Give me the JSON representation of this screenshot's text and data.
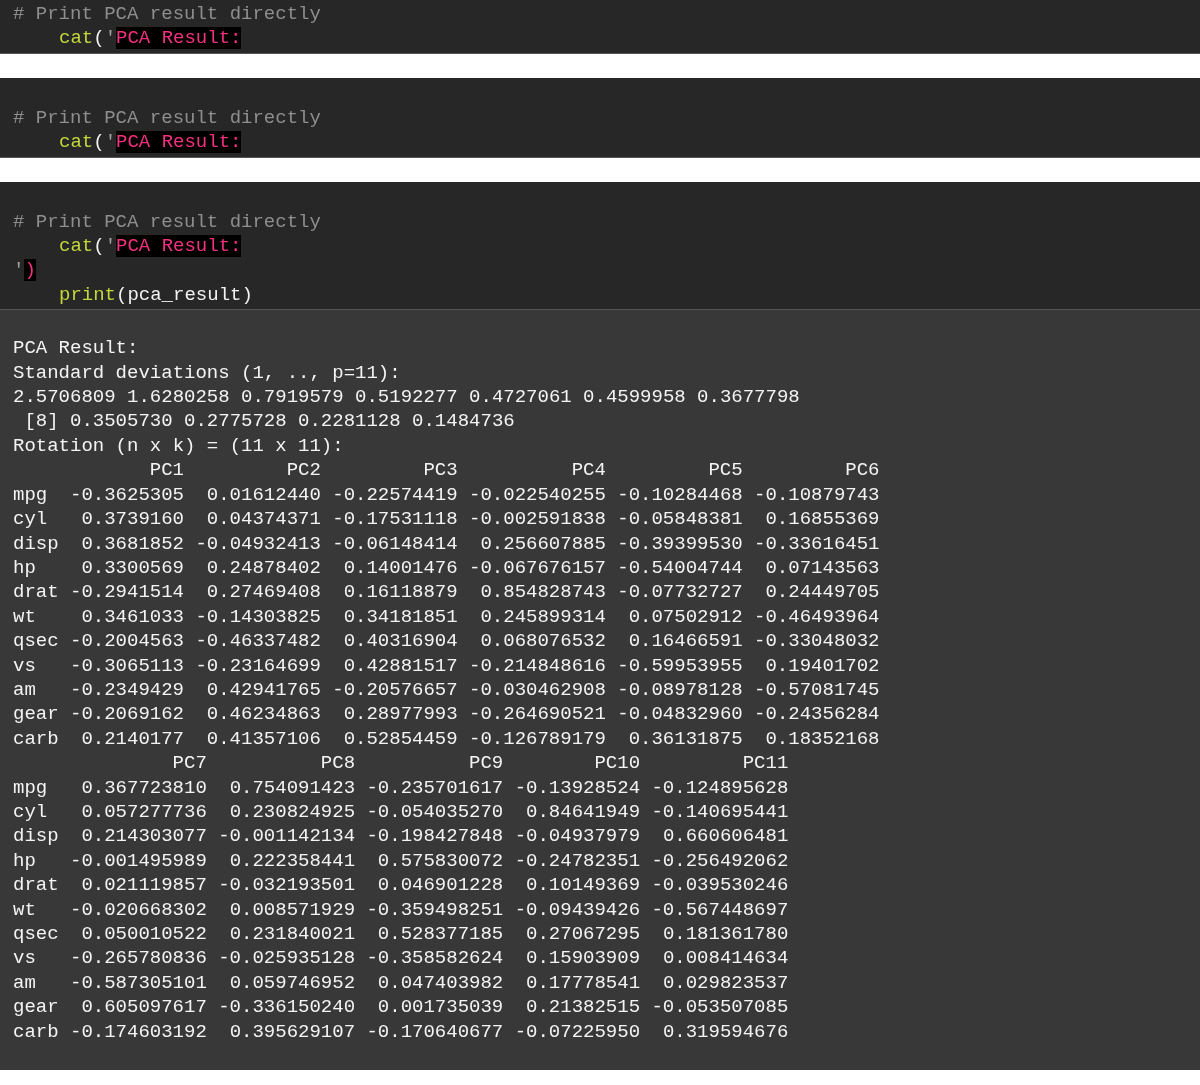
{
  "code_cells": [
    {
      "lines": [
        {
          "indented": false,
          "tokens": [
            {
              "kind": "comment",
              "text": "# Print PCA result directly"
            }
          ]
        },
        {
          "indented": true,
          "tokens": [
            {
              "kind": "function",
              "text": "cat"
            },
            {
              "kind": "punct",
              "text": "("
            },
            {
              "kind": "quote",
              "text": "'"
            },
            {
              "kind": "string",
              "text": "PCA Result:"
            }
          ]
        }
      ]
    },
    {
      "lines": [
        {
          "indented": false,
          "tokens": [
            {
              "kind": "comment",
              "text": "# Print PCA result directly"
            }
          ]
        },
        {
          "indented": true,
          "tokens": [
            {
              "kind": "function",
              "text": "cat"
            },
            {
              "kind": "punct",
              "text": "("
            },
            {
              "kind": "quote",
              "text": "'"
            },
            {
              "kind": "string",
              "text": "PCA Result:"
            }
          ]
        }
      ]
    },
    {
      "lines": [
        {
          "indented": false,
          "tokens": [
            {
              "kind": "comment",
              "text": "# Print PCA result directly"
            }
          ]
        },
        {
          "indented": true,
          "tokens": [
            {
              "kind": "function",
              "text": "cat"
            },
            {
              "kind": "punct",
              "text": "("
            },
            {
              "kind": "quote",
              "text": "'"
            },
            {
              "kind": "string",
              "text": "PCA Result:"
            }
          ]
        },
        {
          "indented": false,
          "tokens": [
            {
              "kind": "quote",
              "text": "'"
            },
            {
              "kind": "string",
              "text": ")"
            }
          ]
        },
        {
          "indented": true,
          "tokens": [
            {
              "kind": "function",
              "text": "print"
            },
            {
              "kind": "punct",
              "text": "(pca_result)"
            }
          ]
        }
      ]
    }
  ],
  "output": {
    "lines": [
      "PCA Result:",
      "Standard deviations (1, .., p=11):",
      "2.5706809 1.6280258 0.7919579 0.5192277 0.4727061 0.4599958 0.3677798",
      " [8] 0.3505730 0.2775728 0.2281128 0.1484736",
      "Rotation (n x k) = (11 x 11):"
    ],
    "tables": [
      {
        "columns": [
          "PC1",
          "PC2",
          "PC3",
          "PC4",
          "PC5",
          "PC6"
        ],
        "rows": [
          {
            "name": "mpg",
            "values": [
              "-0.3625305",
              "0.01612440",
              "-0.22574419",
              "-0.022540255",
              "-0.10284468",
              "-0.10879743"
            ]
          },
          {
            "name": "cyl",
            "values": [
              "0.3739160",
              "0.04374371",
              "-0.17531118",
              "-0.002591838",
              "-0.05848381",
              "0.16855369"
            ]
          },
          {
            "name": "disp",
            "values": [
              "0.3681852",
              "-0.04932413",
              "-0.06148414",
              "0.256607885",
              "-0.39399530",
              "-0.33616451"
            ]
          },
          {
            "name": "hp",
            "values": [
              "0.3300569",
              "0.24878402",
              "0.14001476",
              "-0.067676157",
              "-0.54004744",
              "0.07143563"
            ]
          },
          {
            "name": "drat",
            "values": [
              "-0.2941514",
              "0.27469408",
              "0.16118879",
              "0.854828743",
              "-0.07732727",
              "0.24449705"
            ]
          },
          {
            "name": "wt",
            "values": [
              "0.3461033",
              "-0.14303825",
              "0.34181851",
              "0.245899314",
              "0.07502912",
              "-0.46493964"
            ]
          },
          {
            "name": "qsec",
            "values": [
              "-0.2004563",
              "-0.46337482",
              "0.40316904",
              "0.068076532",
              "0.16466591",
              "-0.33048032"
            ]
          },
          {
            "name": "vs",
            "values": [
              "-0.3065113",
              "-0.23164699",
              "0.42881517",
              "-0.214848616",
              "-0.59953955",
              "0.19401702"
            ]
          },
          {
            "name": "am",
            "values": [
              "-0.2349429",
              "0.42941765",
              "-0.20576657",
              "-0.030462908",
              "-0.08978128",
              "-0.57081745"
            ]
          },
          {
            "name": "gear",
            "values": [
              "-0.2069162",
              "0.46234863",
              "0.28977993",
              "-0.264690521",
              "-0.04832960",
              "-0.24356284"
            ]
          },
          {
            "name": "carb",
            "values": [
              "0.2140177",
              "0.41357106",
              "0.52854459",
              "-0.126789179",
              "0.36131875",
              "0.18352168"
            ]
          }
        ]
      },
      {
        "columns": [
          "PC7",
          "PC8",
          "PC9",
          "PC10",
          "PC11"
        ],
        "rows": [
          {
            "name": "mpg",
            "values": [
              "0.367723810",
              "0.754091423",
              "-0.235701617",
              "-0.13928524",
              "-0.124895628"
            ]
          },
          {
            "name": "cyl",
            "values": [
              "0.057277736",
              "0.230824925",
              "-0.054035270",
              "0.84641949",
              "-0.140695441"
            ]
          },
          {
            "name": "disp",
            "values": [
              "0.214303077",
              "-0.001142134",
              "-0.198427848",
              "-0.04937979",
              "0.660606481"
            ]
          },
          {
            "name": "hp",
            "values": [
              "-0.001495989",
              "0.222358441",
              "0.575830072",
              "-0.24782351",
              "-0.256492062"
            ]
          },
          {
            "name": "drat",
            "values": [
              "0.021119857",
              "-0.032193501",
              "0.046901228",
              "0.10149369",
              "-0.039530246"
            ]
          },
          {
            "name": "wt",
            "values": [
              "-0.020668302",
              "0.008571929",
              "-0.359498251",
              "-0.09439426",
              "-0.567448697"
            ]
          },
          {
            "name": "qsec",
            "values": [
              "0.050010522",
              "0.231840021",
              "0.528377185",
              "0.27067295",
              "0.181361780"
            ]
          },
          {
            "name": "vs",
            "values": [
              "-0.265780836",
              "-0.025935128",
              "-0.358582624",
              "0.15903909",
              "0.008414634"
            ]
          },
          {
            "name": "am",
            "values": [
              "-0.587305101",
              "0.059746952",
              "0.047403982",
              "0.17778541",
              "0.029823537"
            ]
          },
          {
            "name": "gear",
            "values": [
              "0.605097617",
              "-0.336150240",
              "0.001735039",
              "0.21382515",
              "-0.053507085"
            ]
          },
          {
            "name": "carb",
            "values": [
              "-0.174603192",
              "0.395629107",
              "-0.170640677",
              "-0.07225950",
              "0.319594676"
            ]
          }
        ]
      }
    ]
  }
}
